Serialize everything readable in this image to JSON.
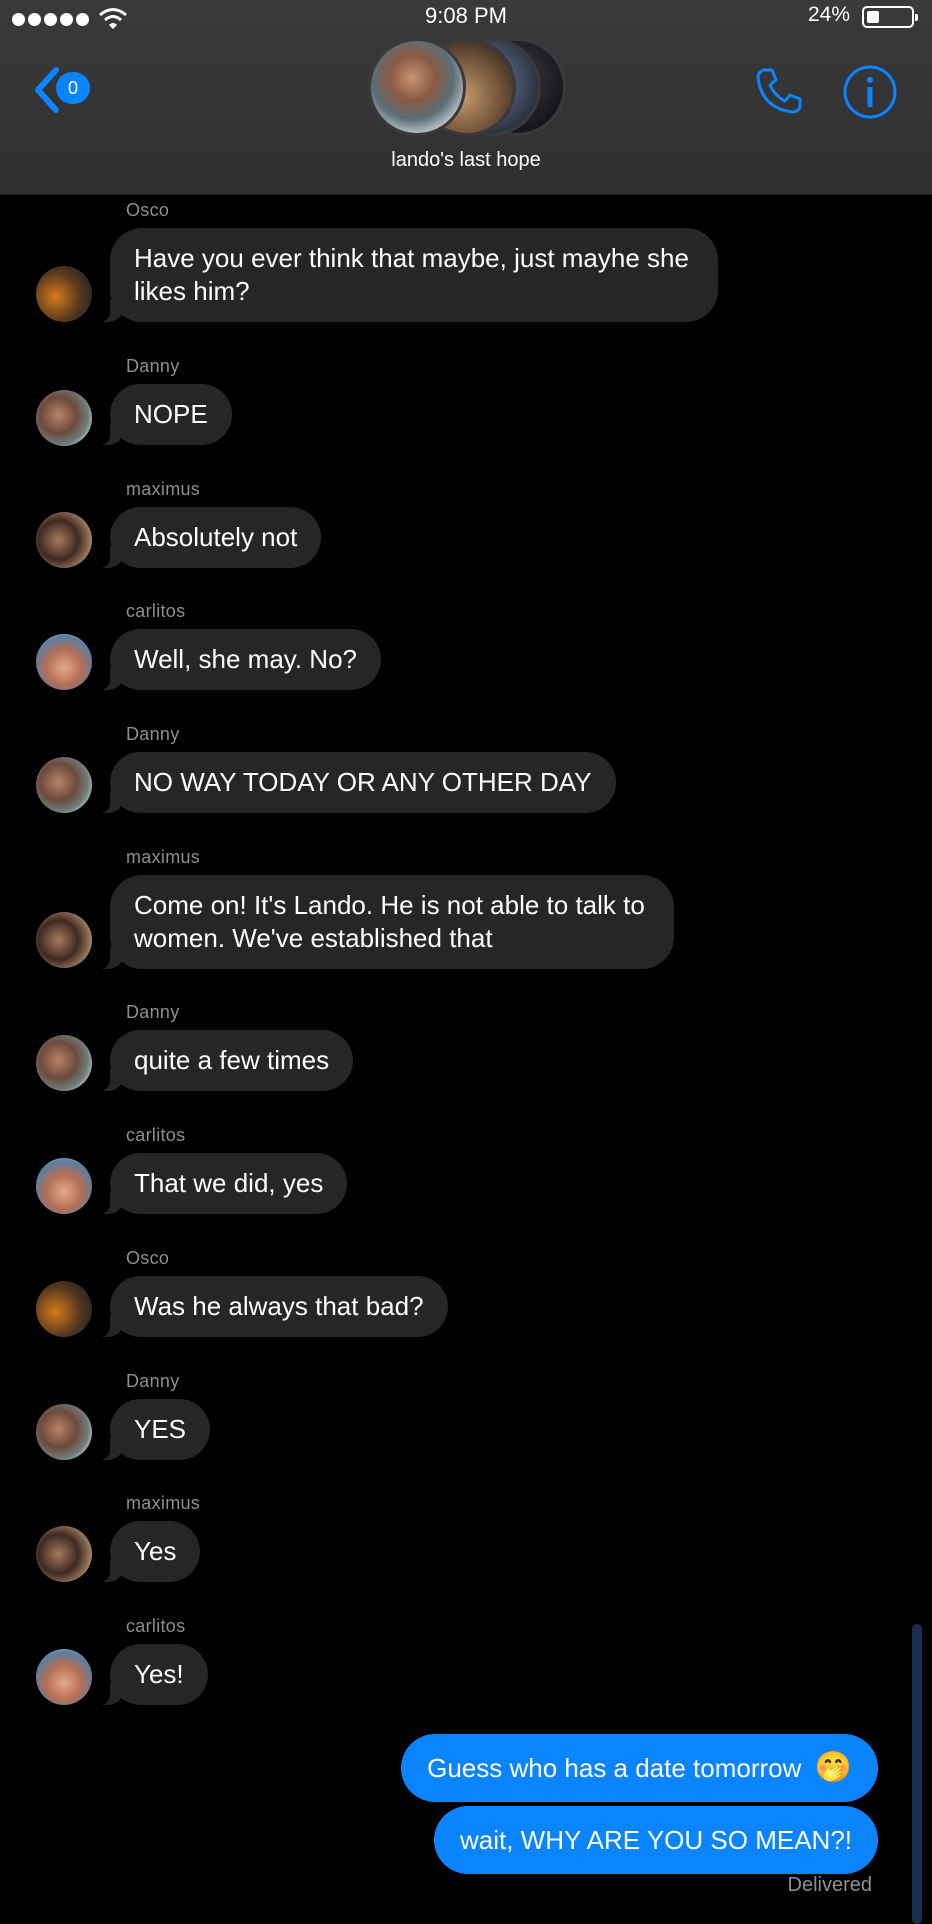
{
  "status": {
    "time": "9:08 PM",
    "battery": "24%"
  },
  "header": {
    "back_badge": "0",
    "group_name": "lando's last hope"
  },
  "colors": {
    "accent": "#0a84ff",
    "incoming_bubble": "#262628",
    "background": "#000000"
  },
  "messages": [
    {
      "sender": "Osco",
      "text": "Have you ever think that maybe, just mayhe she likes him?"
    },
    {
      "sender": "Danny",
      "text": "NOPE"
    },
    {
      "sender": "maximus",
      "text": "Absolutely not"
    },
    {
      "sender": "carlitos",
      "text": "Well, she may. No?"
    },
    {
      "sender": "Danny",
      "text": "NO WAY TODAY OR ANY OTHER DAY"
    },
    {
      "sender": "maximus",
      "text": "Come on! It's Lando. He is not able to talk to women. We've established that"
    },
    {
      "sender": "Danny",
      "text": "quite a few times"
    },
    {
      "sender": "carlitos",
      "text": "That we did, yes"
    },
    {
      "sender": "Osco",
      "text": "Was he always that bad?"
    },
    {
      "sender": "Danny",
      "text": "YES"
    },
    {
      "sender": "maximus",
      "text": "Yes"
    },
    {
      "sender": "carlitos",
      "text": "Yes!"
    }
  ],
  "outgoing": [
    {
      "text": "Guess who has a date tomorrow",
      "emoji": "🤭"
    },
    {
      "text": "wait, WHY ARE YOU SO MEAN?!"
    }
  ],
  "delivered": "Delivered"
}
